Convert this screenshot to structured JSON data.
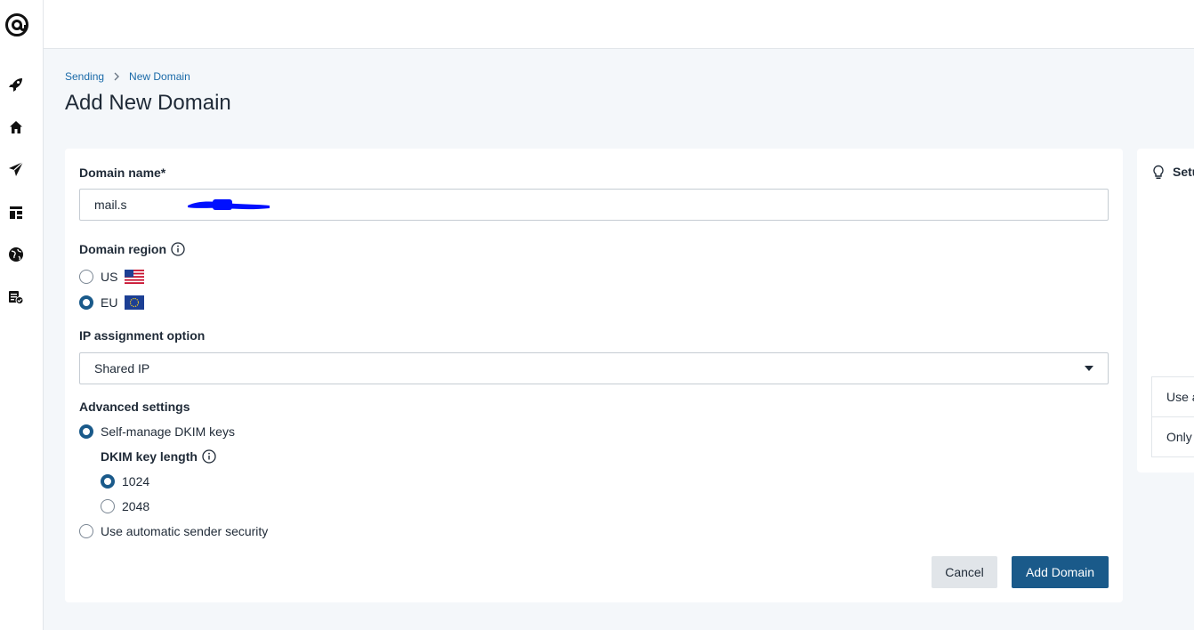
{
  "breadcrumb": {
    "parent": "Sending",
    "current": "New Domain"
  },
  "page": {
    "title": "Add New Domain"
  },
  "form": {
    "domain_label": "Domain name*",
    "domain_value": "mail.s",
    "region_label": "Domain region",
    "region_options": [
      "US",
      "EU"
    ],
    "region_selected": "EU",
    "ip_label": "IP assignment option",
    "ip_value": "Shared IP",
    "advanced_label": "Advanced settings",
    "dkim_self_manage": "Self-manage DKIM keys",
    "dkim_length_label": "DKIM key length",
    "dkim_length_options": [
      "1024",
      "2048"
    ],
    "dkim_length_selected": "1024",
    "auto_security": "Use automatic sender security",
    "cancel_label": "Cancel",
    "submit_label": "Add Domain"
  },
  "side_panel": {
    "title": "Setu",
    "rows": [
      "Use a",
      "Only"
    ]
  },
  "colors": {
    "primary": "#1a5a8a",
    "link": "#1a6aa8",
    "redaction": "#0010ff",
    "background": "#f4f7fa"
  },
  "icons": {
    "logo": "at-sign-logo-icon",
    "nav": [
      "rocket-icon",
      "home-icon",
      "send-icon",
      "dashboard-icon",
      "globe-icon",
      "checklist-icon"
    ]
  }
}
